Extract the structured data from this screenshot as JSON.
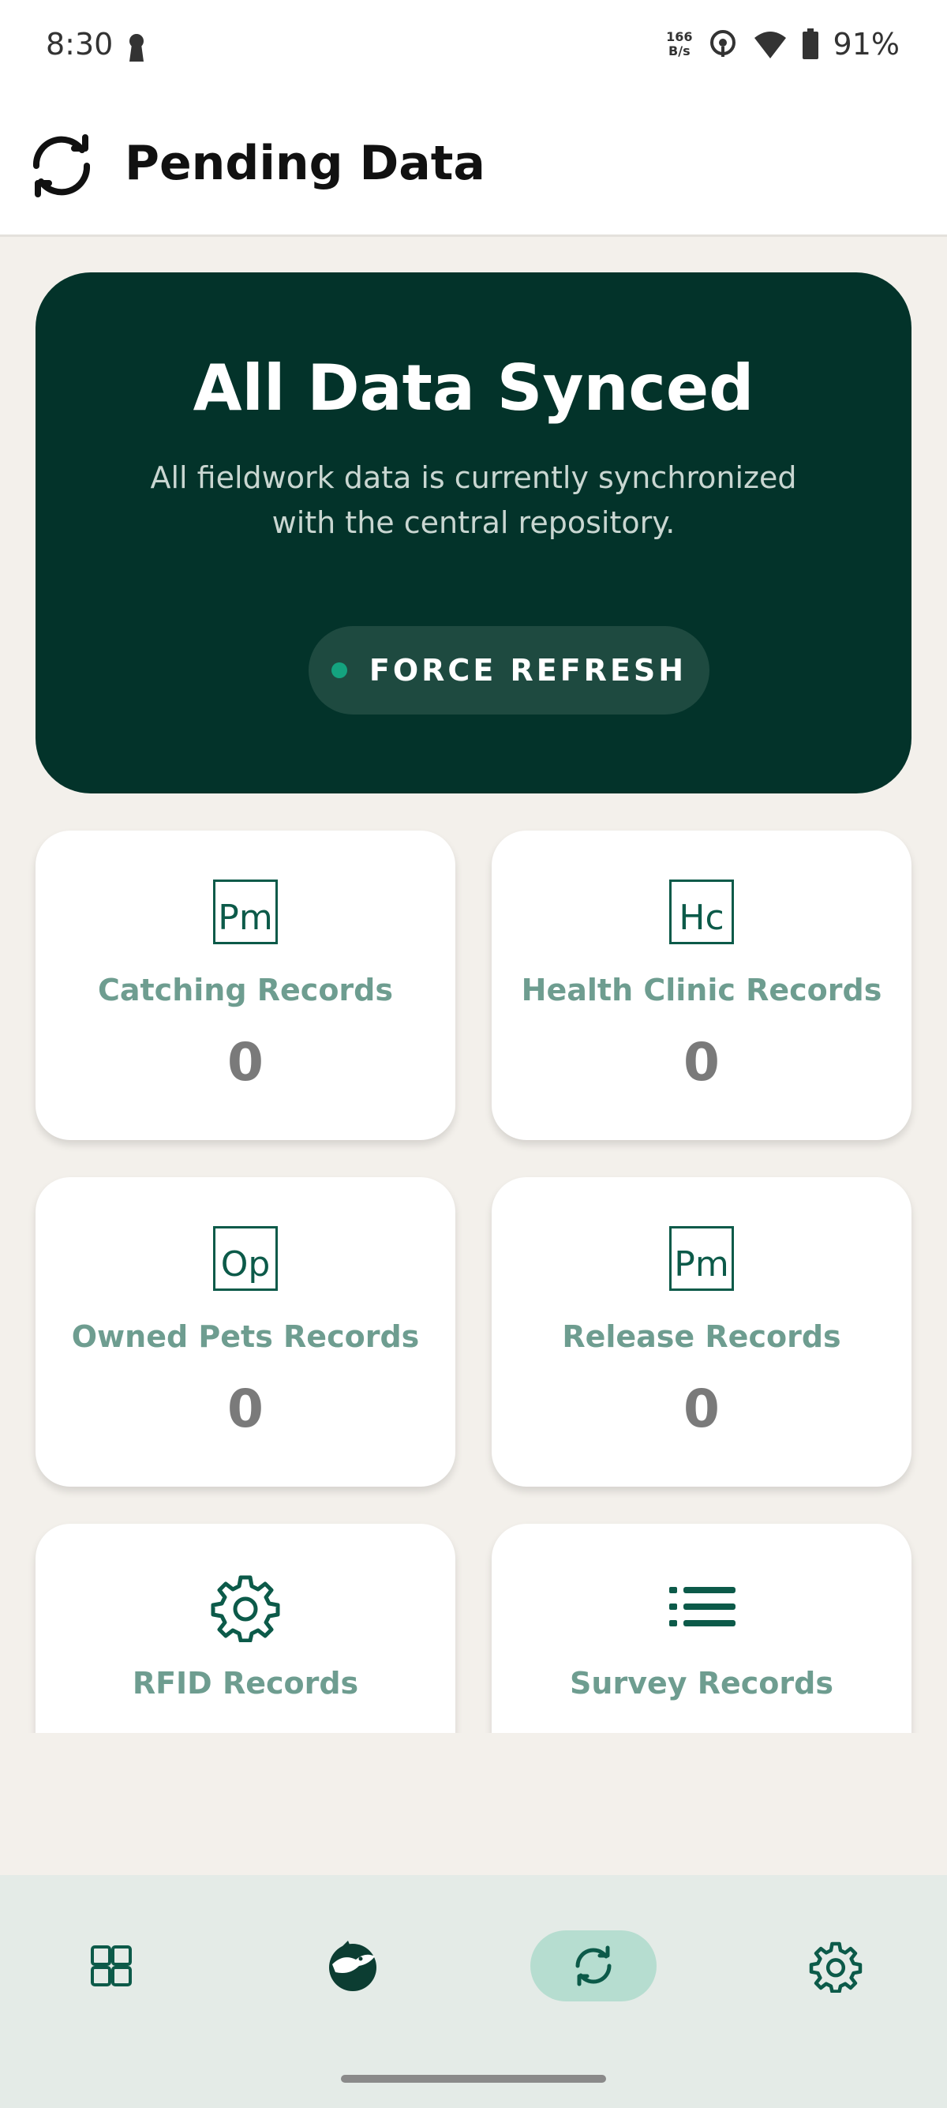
{
  "status_bar": {
    "time": "8:30",
    "net_speed_value": "166",
    "net_speed_unit": "B/s",
    "battery": "91%"
  },
  "app_bar": {
    "title": "Pending Data"
  },
  "hero": {
    "title": "All Data Synced",
    "subtitle": "All fieldwork data is currently synchronized with the central repository.",
    "button_label": "FORCE REFRESH"
  },
  "cards": [
    {
      "icon_text": "Pm",
      "label": "Catching Records",
      "count": "0"
    },
    {
      "icon_text": "Hc",
      "label": "Health Clinic Records",
      "count": "0"
    },
    {
      "icon_text": "Op",
      "label": "Owned Pets Records",
      "count": "0"
    },
    {
      "icon_text": "Pm",
      "label": "Release Records",
      "count": "0"
    },
    {
      "icon": "gear-icon",
      "label": "RFID Records"
    },
    {
      "icon": "list-icon",
      "label": "Survey Records"
    }
  ],
  "bottom_nav": {
    "items": [
      "dashboard-icon",
      "logo-icon",
      "sync-icon",
      "settings-icon"
    ],
    "active": "sync-icon"
  },
  "colors": {
    "hero_bg": "#03332a",
    "accent": "#0c5a49",
    "card_label": "#6e9d90",
    "nav_active": "#b6ddd0"
  }
}
